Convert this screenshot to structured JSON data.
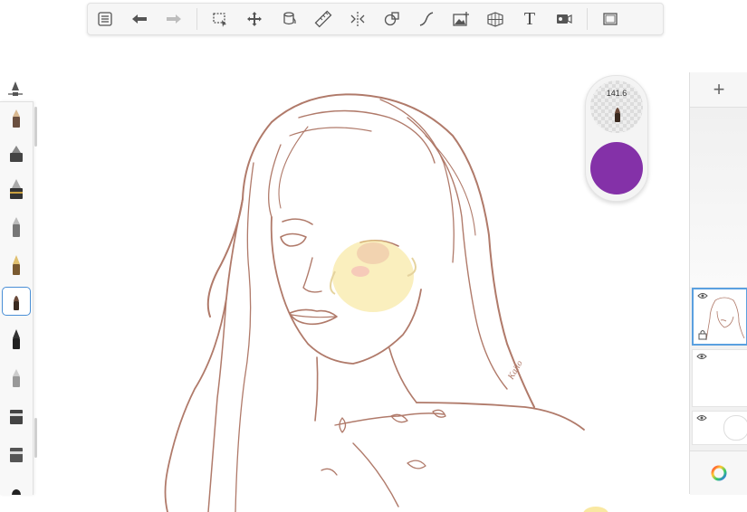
{
  "toolbar": {
    "items": [
      {
        "name": "menu-list-icon"
      },
      {
        "name": "undo-arrow-icon"
      },
      {
        "name": "redo-arrow-icon"
      },
      {
        "name": "selection-icon"
      },
      {
        "name": "transform-move-icon"
      },
      {
        "name": "fill-bucket-icon"
      },
      {
        "name": "ruler-icon"
      },
      {
        "name": "symmetry-icon"
      },
      {
        "name": "shapes-icon"
      },
      {
        "name": "stroke-curve-icon"
      },
      {
        "name": "import-image-icon"
      },
      {
        "name": "perspective-grid-icon"
      },
      {
        "name": "text-tool-icon"
      },
      {
        "name": "timelapse-video-icon"
      },
      {
        "name": "fullscreen-icon"
      }
    ],
    "text_tool_glyph": "T"
  },
  "brushes": {
    "count": 11,
    "active_index": 5
  },
  "puck": {
    "brush_size": "141.6",
    "color": "#8431a8"
  },
  "layers": {
    "add_label": "+",
    "items": [
      {
        "name": "layer-sketch",
        "visible": true,
        "active": true
      },
      {
        "name": "layer-2",
        "visible": true,
        "active": false
      },
      {
        "name": "layer-background",
        "visible": true,
        "active": false
      }
    ]
  },
  "colors": {
    "accent": "#4a8fd6",
    "line_art": "#b07a6a",
    "current_color": "#8431a8"
  }
}
